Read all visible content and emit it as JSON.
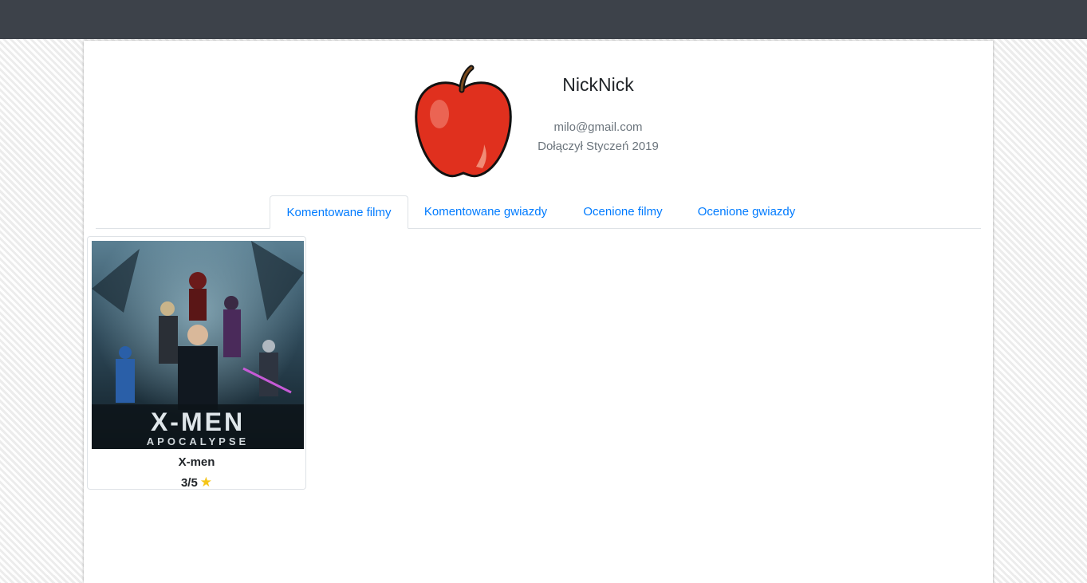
{
  "profile": {
    "name": "NickNick",
    "email": "milo@gmail.com",
    "joined": "Dołączył Styczeń 2019",
    "avatar_icon": "apple-icon"
  },
  "tabs": [
    {
      "label": "Komentowane filmy",
      "active": true
    },
    {
      "label": "Komentowane gwiazdy",
      "active": false
    },
    {
      "label": "Ocenione filmy",
      "active": false
    },
    {
      "label": "Ocenione gwiazdy",
      "active": false
    }
  ],
  "movies": [
    {
      "title": "X-men",
      "rating_text": "3/5",
      "poster_title": "X-MEN",
      "poster_subtitle": "APOCALYPSE",
      "rating_icon": "star-icon"
    }
  ],
  "colors": {
    "topbar": "#3d424a",
    "link": "#007bff",
    "star": "#f5c518",
    "apple": "#e0301e"
  }
}
